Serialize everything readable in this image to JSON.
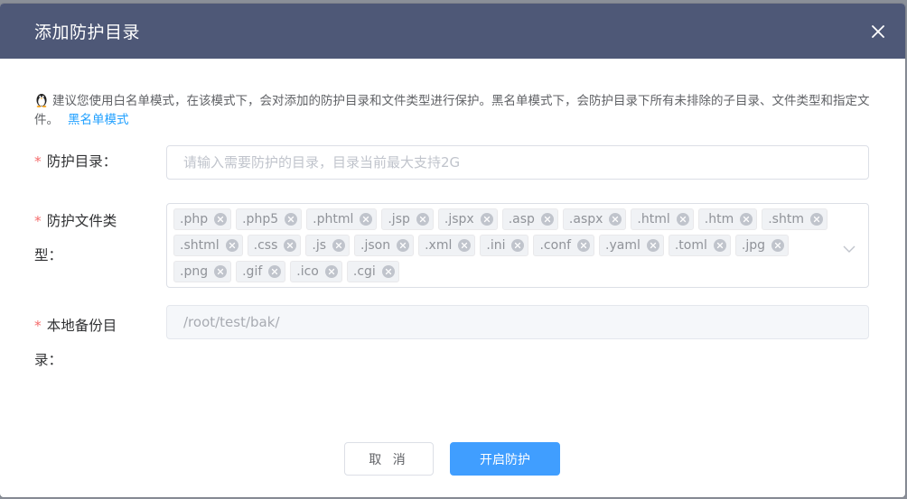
{
  "dialog": {
    "title": "添加防护目录",
    "notice": "建议您使用白名单模式，在该模式下，会对添加的防护目录和文件类型进行保护。黑名单模式下，会防护目录下所有未排除的子目录、文件类型和指定文件。",
    "notice_link": "黑名单模式"
  },
  "form": {
    "dir_label": "防护目录：",
    "dir_placeholder": "请输入需要防护的目录，目录当前最大支持2G",
    "types_label": "防护文件类型：",
    "file_types": [
      ".php",
      ".php5",
      ".phtml",
      ".jsp",
      ".jspx",
      ".asp",
      ".aspx",
      ".html",
      ".htm",
      ".shtm",
      ".shtml",
      ".css",
      ".js",
      ".json",
      ".xml",
      ".ini",
      ".conf",
      ".yaml",
      ".toml",
      ".jpg",
      ".png",
      ".gif",
      ".ico",
      ".cgi"
    ],
    "backup_label": "本地备份目录：",
    "backup_value": "/root/test/bak/"
  },
  "buttons": {
    "cancel": "取 消",
    "confirm": "开启防护"
  },
  "colors": {
    "header": "#4e5877",
    "primary": "#409eff",
    "required": "#f56c6c",
    "link": "#20a0ff"
  }
}
